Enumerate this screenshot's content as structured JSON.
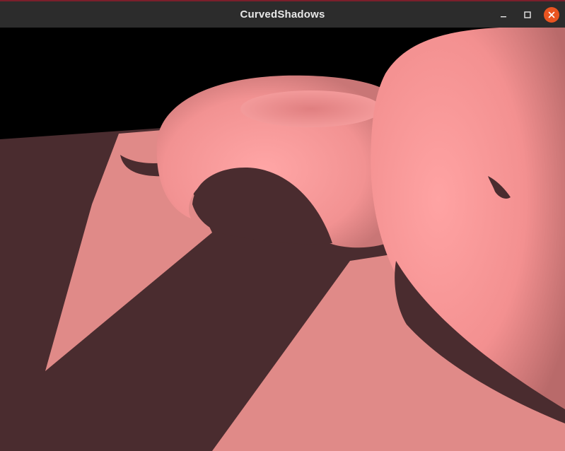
{
  "window": {
    "title": "CurvedShadows",
    "controls": {
      "minimize_icon": "minimize-icon",
      "maximize_icon": "maximize-icon",
      "close_icon": "close-icon"
    },
    "accent_close": "#e95420"
  },
  "scene": {
    "background": "#000000",
    "lit_color": "#e08a88",
    "shadow_color": "#4a2c2f",
    "object_color": "#ff9b9b"
  }
}
